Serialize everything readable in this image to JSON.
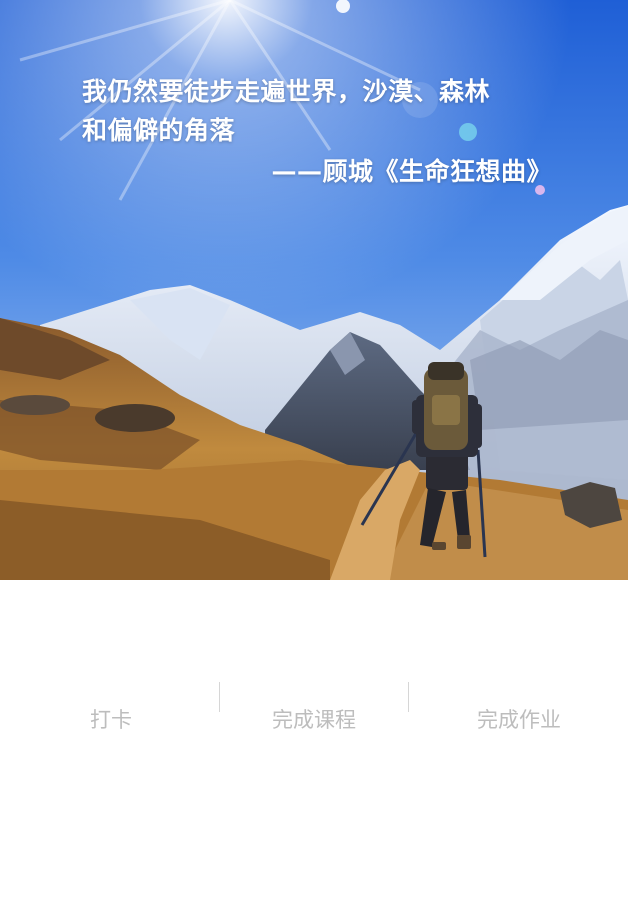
{
  "hero": {
    "quote_line1": "我仍然要徒步走遍世界，沙漠、森林",
    "quote_line2": "和偏僻的角落",
    "attribution": "——顾城《生命狂想曲》"
  },
  "tabs": [
    {
      "label": "打卡"
    },
    {
      "label": "完成课程"
    },
    {
      "label": "完成作业"
    }
  ],
  "colors": {
    "sky_top": "#2f6fdc",
    "sky_bottom": "#8fb8ef",
    "tab_text": "#bdbdbd",
    "divider": "#d6d6d6"
  }
}
